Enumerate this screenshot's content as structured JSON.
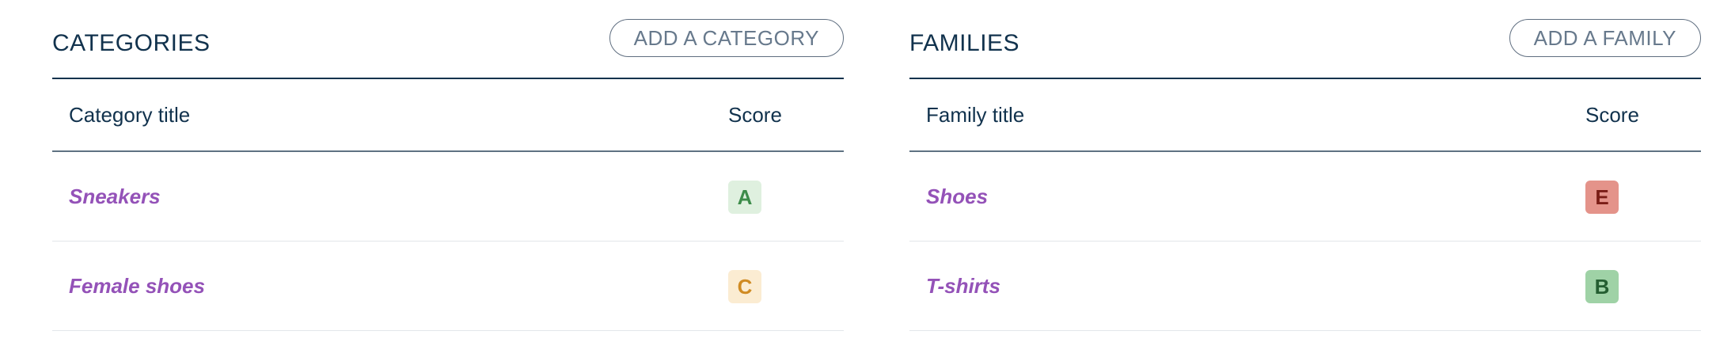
{
  "categories": {
    "title": "CATEGORIES",
    "add_button_label": "ADD A CATEGORY",
    "columns": {
      "title": "Category title",
      "score": "Score"
    },
    "rows": [
      {
        "name": "Sneakers",
        "score": "A",
        "badge_bg": "#dff0df",
        "badge_fg": "#3d8c4a"
      },
      {
        "name": "Female shoes",
        "score": "C",
        "badge_bg": "#fbecd2",
        "badge_fg": "#d08b23"
      }
    ]
  },
  "families": {
    "title": "FAMILIES",
    "add_button_label": "ADD A FAMILY",
    "columns": {
      "title": "Family title",
      "score": "Score"
    },
    "rows": [
      {
        "name": "Shoes",
        "score": "E",
        "badge_bg": "#e4938a",
        "badge_fg": "#7a1d16"
      },
      {
        "name": "T-shirts",
        "score": "B",
        "badge_bg": "#9fd2a6",
        "badge_fg": "#245e31"
      }
    ]
  },
  "colors": {
    "navy": "#11324d",
    "link_purple": "#9452b8",
    "button_text": "#67798c",
    "divider_light": "#e3e6ea"
  }
}
